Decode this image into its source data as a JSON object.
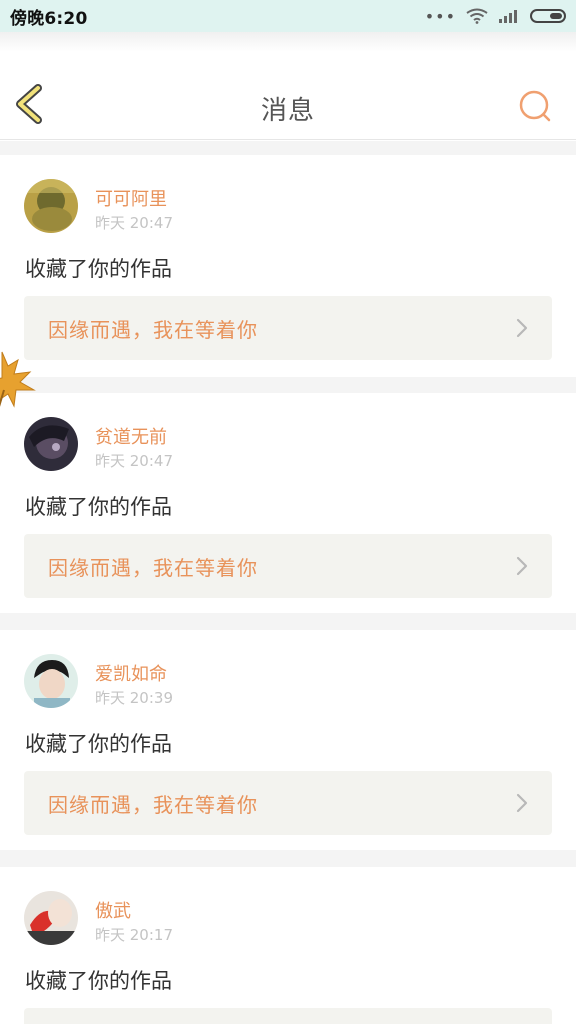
{
  "status_bar": {
    "time": "傍晚6:20",
    "dots": "•••"
  },
  "header": {
    "title": "消息"
  },
  "colors": {
    "accent": "#e8925a",
    "back_icon_fill": "#f2e27a",
    "statusbar_bg": "#dff3f0"
  },
  "notifications": [
    {
      "username": "可可阿里",
      "time": "昨天 20:47",
      "action": "收藏了你的作品",
      "work_title": "因缘而遇，我在等着你"
    },
    {
      "username": "贫道无前",
      "time": "昨天 20:47",
      "action": "收藏了你的作品",
      "work_title": "因缘而遇，我在等着你"
    },
    {
      "username": "爱凯如命",
      "time": "昨天 20:39",
      "action": "收藏了你的作品",
      "work_title": "因缘而遇，我在等着你"
    },
    {
      "username": "傲武",
      "time": "昨天 20:17",
      "action": "收藏了你的作品",
      "work_title": ""
    }
  ]
}
